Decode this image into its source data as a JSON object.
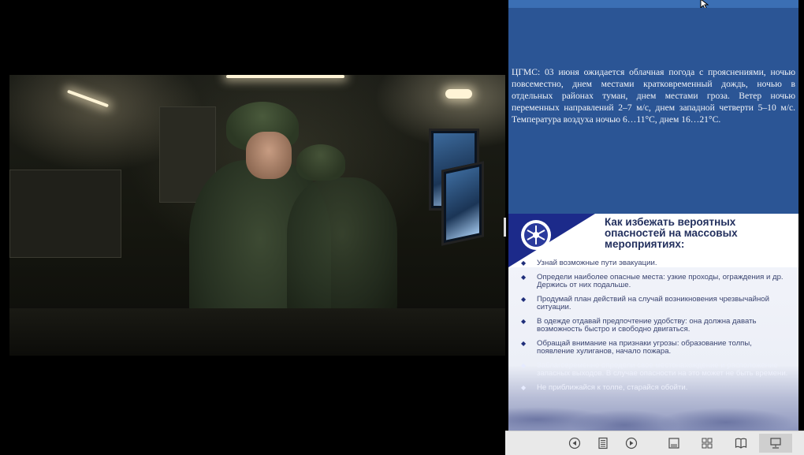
{
  "weather": {
    "text": "ЦГМС: 03 июня ожидается облачная погода с прояснениями, ночью повсеместно, днем местами кратковременный дождь, ночью в отдельных районах туман, днем местами гроза. Ветер ночью переменных направлений 2–7 м/с, днем западной четверти 5–10 м/с. Температура воздуха ночью 6…11°С, днем 16…21°С."
  },
  "safety": {
    "title": "Как избежать вероятных опасностей на массовых мероприятиях:",
    "tips": [
      "Узнай возможные пути эвакуации.",
      "Определи наиболее опасные места: узкие проходы, ограждения и др. Держись от них подальше.",
      "Продумай план действий на случай возникновения чрезвычайной ситуации.",
      "В одежде отдавай предпочтение удобству: она должна давать возможность быстро и свободно двигаться.",
      "Обращай внимание на признаки угрозы: образование толпы, появление хулиганов, начало пожара.",
      "Заблаговременно определи свое местонахождение и расположение запасных выходов. В случае опасности на это может не быть времени.",
      "Не приближайся к толпе, старайся обойти."
    ]
  },
  "toolbar": {
    "icons": [
      "prev-icon",
      "notes-icon",
      "next-icon",
      "slide-icon",
      "grid-icon",
      "book-icon",
      "presenter-icon"
    ],
    "active": "presenter-icon"
  },
  "colors": {
    "weather_bg": "#2b5595",
    "accent_strip": "#3b6fb4",
    "title": "#23305e",
    "toolbar_bg": "#e9e9e9"
  }
}
